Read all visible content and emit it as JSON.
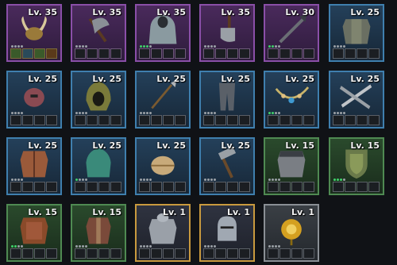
{
  "items": [
    {
      "level": "Lv. 35",
      "rarity": "purple",
      "icon": "horned-helmet-icon",
      "stars_lit": 0,
      "gems": [
        "green",
        "teal",
        "green",
        "orange"
      ]
    },
    {
      "level": "Lv. 35",
      "rarity": "purple",
      "icon": "axe-icon",
      "stars_lit": 0,
      "gems": []
    },
    {
      "level": "Lv. 35",
      "rarity": "purple",
      "icon": "cloak-icon",
      "stars_lit": 3,
      "gems": []
    },
    {
      "level": "Lv. 35",
      "rarity": "purple",
      "icon": "cleaver-icon",
      "stars_lit": 0,
      "gems": []
    },
    {
      "level": "Lv. 30",
      "rarity": "purple",
      "icon": "dagger-icon",
      "stars_lit": 2,
      "gems": []
    },
    {
      "level": "Lv. 25",
      "rarity": "blue",
      "icon": "plate-armor-icon",
      "stars_lit": 0,
      "gems": []
    },
    {
      "level": "Lv. 25",
      "rarity": "blue",
      "icon": "red-helmet-icon",
      "stars_lit": 0,
      "gems": []
    },
    {
      "level": "Lv. 25",
      "rarity": "blue",
      "icon": "hood-icon",
      "stars_lit": 0,
      "gems": []
    },
    {
      "level": "Lv. 25",
      "rarity": "blue",
      "icon": "spear-icon",
      "stars_lit": 0,
      "gems": []
    },
    {
      "level": "Lv. 25",
      "rarity": "blue",
      "icon": "leggings-icon",
      "stars_lit": 0,
      "gems": []
    },
    {
      "level": "Lv. 25",
      "rarity": "blue",
      "icon": "necklace-icon",
      "stars_lit": 2,
      "gems": []
    },
    {
      "level": "Lv. 25",
      "rarity": "blue",
      "icon": "crossed-blades-icon",
      "stars_lit": 0,
      "gems": []
    },
    {
      "level": "Lv. 25",
      "rarity": "blue",
      "icon": "leather-vest-icon",
      "stars_lit": 0,
      "gems": []
    },
    {
      "level": "Lv. 25",
      "rarity": "blue",
      "icon": "teal-cloak-icon",
      "stars_lit": 1,
      "gems": []
    },
    {
      "level": "Lv. 25",
      "rarity": "blue",
      "icon": "wrap-helmet-icon",
      "stars_lit": 0,
      "gems": []
    },
    {
      "level": "Lv. 25",
      "rarity": "blue",
      "icon": "hammer-icon",
      "stars_lit": 0,
      "gems": []
    },
    {
      "level": "Lv. 15",
      "rarity": "green",
      "icon": "chainmail-icon",
      "stars_lit": 0,
      "gems": []
    },
    {
      "level": "Lv. 15",
      "rarity": "green",
      "icon": "shield-icon",
      "stars_lit": 3,
      "gems": []
    },
    {
      "level": "Lv. 15",
      "rarity": "green",
      "icon": "leather-armor-icon",
      "stars_lit": 2,
      "gems": []
    },
    {
      "level": "Lv. 15",
      "rarity": "green",
      "icon": "tunic-icon",
      "stars_lit": 0,
      "gems": []
    },
    {
      "level": "Lv. 1",
      "rarity": "gold",
      "icon": "knight-armor-icon",
      "stars_lit": 0,
      "gems": []
    },
    {
      "level": "Lv. 1",
      "rarity": "gold",
      "icon": "knight-helmet-icon",
      "stars_lit": 0,
      "gems": []
    },
    {
      "level": "Lv. 1",
      "rarity": "grey",
      "icon": "golden-flower-icon",
      "stars_lit": 0,
      "gems": []
    }
  ]
}
